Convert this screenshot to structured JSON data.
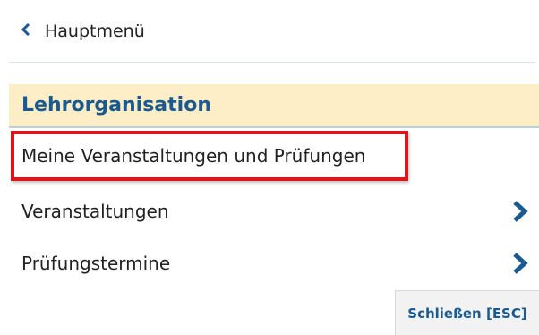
{
  "nav": {
    "back_label": "Hauptmenü",
    "section_title": "Lehrorganisation"
  },
  "menu": {
    "items": [
      {
        "label": "Meine Veranstaltungen und Prüfungen",
        "has_submenu": false,
        "highlighted": true
      },
      {
        "label": "Veranstaltungen",
        "has_submenu": true,
        "highlighted": false
      },
      {
        "label": "Prüfungstermine",
        "has_submenu": true,
        "highlighted": false
      }
    ]
  },
  "footer": {
    "close_label": "Schließen [ESC]"
  },
  "colors": {
    "accent": "#1b5a8e",
    "header_bg": "#fdeec7",
    "highlight": "#e0141b"
  },
  "icons": {
    "back": "chevron-left-icon",
    "submenu": "chevron-right-icon"
  }
}
